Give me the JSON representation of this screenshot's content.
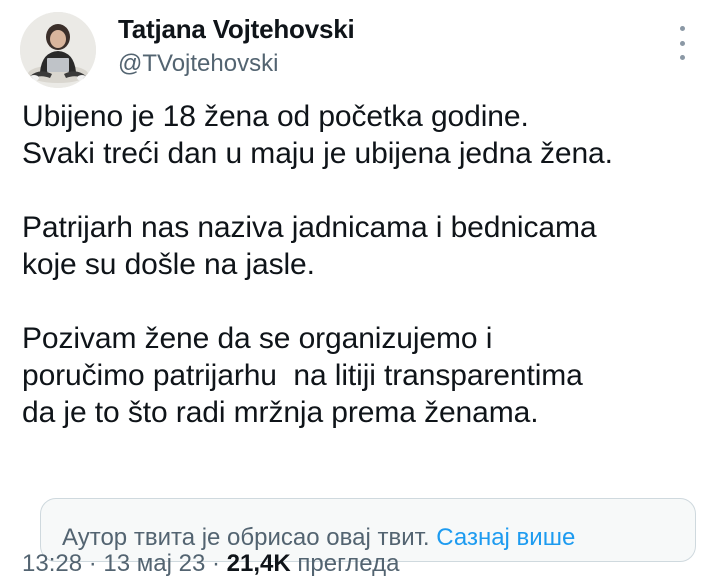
{
  "author": {
    "name": "Tatjana Vojtehovski",
    "handle": "@TVojtehovski"
  },
  "tweet": {
    "paragraphs": [
      [
        "Ubijeno je 18 žena od početka godine.",
        "Svaki treći dan u maju je ubijena jedna žena."
      ],
      [
        "Patrijarh nas naziva jadnicama i bednicama",
        "koje su došle na jasle."
      ],
      [
        "Pozivam žene da se organizujemo i",
        "poručimo patrijarhu  na litiji transparentima",
        "da je to što radi mržnja prema ženama."
      ]
    ]
  },
  "notice": {
    "text": "Аутор твита је обрисао овај твит.",
    "link": "Сазнај више"
  },
  "meta": {
    "time": "13:28",
    "separator": "·",
    "date": "13 мај 23",
    "views_count": "21,4K",
    "views_label": "прегледа"
  },
  "icons": {
    "more": "more-vertical-icon"
  },
  "colors": {
    "text_primary": "#0f1419",
    "text_secondary": "#536471",
    "link": "#1d9bf0",
    "notice_bg": "#f7f9f9",
    "notice_border": "#cfd9de"
  }
}
